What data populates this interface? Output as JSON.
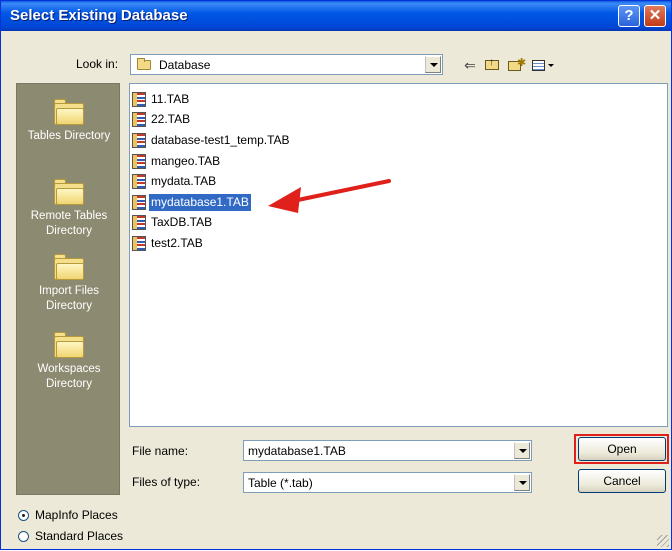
{
  "window": {
    "title": "Select Existing Database"
  },
  "toolbar": {
    "look_in_label": "Look in:",
    "look_in_value": "Database"
  },
  "places": [
    {
      "label": "Tables Directory"
    },
    {
      "label": "Remote Tables Directory"
    },
    {
      "label": "Import Files Directory"
    },
    {
      "label": "Workspaces Directory"
    }
  ],
  "files": [
    {
      "name": "11.TAB"
    },
    {
      "name": "22.TAB"
    },
    {
      "name": "database-test1_temp.TAB"
    },
    {
      "name": "mangeo.TAB"
    },
    {
      "name": "mydata.TAB"
    },
    {
      "name": "mydatabase1.TAB",
      "selected": true
    },
    {
      "name": "TaxDB.TAB"
    },
    {
      "name": "test2.TAB"
    }
  ],
  "form": {
    "file_name_label": "File name:",
    "file_name_value": "mydatabase1.TAB",
    "file_type_label": "Files of type:",
    "file_type_value": "Table (*.tab)"
  },
  "buttons": {
    "open": "Open",
    "cancel": "Cancel"
  },
  "radio": [
    {
      "label": "MapInfo Places",
      "checked": true
    },
    {
      "label": "Standard Places",
      "checked": false
    }
  ],
  "colors": {
    "selection": "#316ac5",
    "annotation": "#e0201a",
    "titlebar": "#0054e3"
  }
}
